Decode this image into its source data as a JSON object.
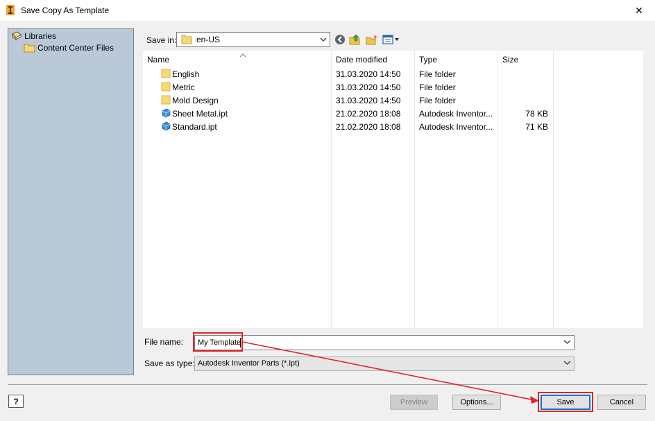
{
  "window": {
    "title": "Save Copy As Template",
    "close_glyph": "✕"
  },
  "sidebar": {
    "items": [
      {
        "label": "Libraries",
        "icon": "library-icon"
      },
      {
        "label": "Content Center Files",
        "icon": "folder-icon"
      }
    ]
  },
  "save_in": {
    "label": "Save in:",
    "value": "en-US"
  },
  "toolbar": {
    "icons": [
      "back-icon",
      "up-folder-icon",
      "new-folder-icon",
      "view-menu-icon"
    ]
  },
  "file_list": {
    "columns": [
      "Name",
      "Date modified",
      "Type",
      "Size"
    ],
    "rows": [
      {
        "name": "English",
        "date": "31.03.2020 14:50",
        "type": "File folder",
        "size": "",
        "icon": "folder-icon"
      },
      {
        "name": "Metric",
        "date": "31.03.2020 14:50",
        "type": "File folder",
        "size": "",
        "icon": "folder-icon"
      },
      {
        "name": "Mold Design",
        "date": "31.03.2020 14:50",
        "type": "File folder",
        "size": "",
        "icon": "folder-icon"
      },
      {
        "name": "Sheet Metal.ipt",
        "date": "21.02.2020 18:08",
        "type": "Autodesk Inventor...",
        "size": "78 KB",
        "icon": "part-file-icon"
      },
      {
        "name": "Standard.ipt",
        "date": "21.02.2020 18:08",
        "type": "Autodesk Inventor...",
        "size": "71 KB",
        "icon": "part-file-icon"
      }
    ]
  },
  "file_name": {
    "label": "File name:",
    "value": "My Template"
  },
  "save_as_type": {
    "label": "Save as type:",
    "value": "Autodesk Inventor Parts (*.ipt)"
  },
  "buttons": {
    "help": "?",
    "preview": "Preview",
    "options": "Options...",
    "save": "Save",
    "cancel": "Cancel"
  },
  "colors": {
    "annotation": "#e32227",
    "sidebar_bg": "#b9c9d8",
    "focus": "#0078d7"
  }
}
